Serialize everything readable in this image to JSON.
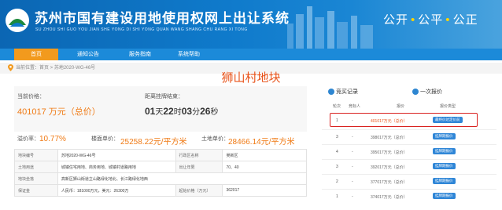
{
  "header": {
    "title": "苏州市国有建设用地使用权网上出让系统",
    "subtitle": "SU ZHOU SHI GUO YOU JIAN SHE YONG DI SHI YONG QUAN WANG SHANG CHU RANG XI TONG",
    "slogan": [
      "公开",
      "公平",
      "公正"
    ],
    "slogan_dot": "•"
  },
  "nav": {
    "items": [
      {
        "label": "首页",
        "active": true
      },
      {
        "label": "通知公告",
        "active": false
      },
      {
        "label": "服务指南",
        "active": false
      },
      {
        "label": "系统帮助",
        "active": false
      }
    ]
  },
  "breadcrumb": "当前位置：首页 > 苏地2020-WG-46号",
  "page_title": "狮山村地块",
  "auction": {
    "current_price_label": "当前价格：",
    "current_price": "401017 万元（总价）",
    "countdown_label": "距离挂牌结束：",
    "countdown": {
      "days": "01",
      "d_unit": "天",
      "hours": "22",
      "h_unit": "时",
      "minutes": "03",
      "m_unit": "分",
      "seconds": "26",
      "s_unit": "秒"
    },
    "premium_label": "溢价率：",
    "premium_value": "10.77%",
    "floor_price_label": "楼面单价：",
    "floor_price_value": "25258.22元/平方米",
    "land_price_label": "土地单价：",
    "land_price_value": "28466.14元/平方米"
  },
  "info_rows": [
    [
      "地块编号",
      "苏地2020-WG-46号",
      "行政区名称",
      "吴新区"
    ],
    [
      "土地用途",
      "城镇住宅用地、商务用地、城镇村道路用地",
      "出让年限",
      "70、40"
    ],
    [
      "地块坐落",
      "高新区狮山街道立山路绿化地北、长江路绿化地西",
      "",
      ""
    ],
    [
      "保证金",
      "人民币：181000万元，美元：26300万",
      "起始价格（万元）",
      "362017"
    ]
  ],
  "bids": {
    "tab_records": "竞买记录",
    "tab_once": "一次报价",
    "columns": [
      "轮次",
      "竞标人",
      "报价",
      "报价类型"
    ],
    "rows": [
      {
        "round": "1",
        "bidder": "-",
        "price": "401017万元（总价）",
        "type": "最终价达定价前"
      },
      {
        "round": "3",
        "bidder": "-",
        "price": "398017万元（总价）",
        "type": "挂牌期报价"
      },
      {
        "round": "4",
        "bidder": "-",
        "price": "395017万元（总价）",
        "type": "挂牌期报价"
      },
      {
        "round": "3",
        "bidder": "-",
        "price": "392017万元（总价）",
        "type": "挂牌期报价"
      },
      {
        "round": "2",
        "bidder": "-",
        "price": "377017万元（总价）",
        "type": "挂牌期报价"
      },
      {
        "round": "1",
        "bidder": "-",
        "price": "374017万元（总价）",
        "type": "挂牌期报价"
      }
    ]
  },
  "colors": {
    "header_blue": "#0f7acb",
    "nav_blue": "#1c8ad9",
    "active_orange": "#f29a1d",
    "price_orange": "#f07b16",
    "title_red": "#e8531a",
    "highlight_red": "#d9211f",
    "tag_blue": "#2f86d7"
  },
  "icons": [
    "logo-icon",
    "location-pin-icon",
    "bid-record-icon",
    "once-bid-icon"
  ]
}
